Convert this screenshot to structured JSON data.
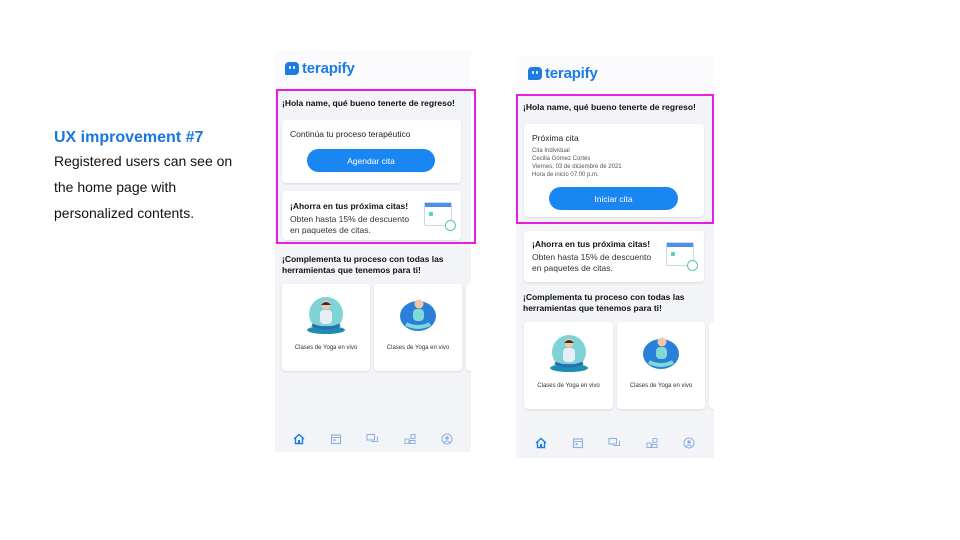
{
  "caption": {
    "title": "UX improvement #7",
    "lines": [
      "Registered users can see on",
      "the home page with",
      "personalized contents."
    ]
  },
  "brand": {
    "name": "terapify",
    "color": "#1a7de6"
  },
  "phone_left": {
    "greeting": "¡Hola name, qué bueno tenerte de regreso!",
    "process_text": "Continúa tu proceso terapéutico",
    "button": "Agendar cita",
    "promo_title": "¡Ahorra en tus próxima citas!",
    "promo_line1": "Obten hasta 15% de descuento",
    "promo_line2": "en paquetes de citas.",
    "section_line1": "¡Complementa tu proceso con todas las",
    "section_line2": "herramientas que tenemos para ti!",
    "tiles": [
      "Clases de Yoga en vivo",
      "Clases de Yoga en vivo"
    ]
  },
  "phone_right": {
    "greeting": "¡Hola name, qué bueno tenerte de regreso!",
    "next_title": "Próxima cita",
    "detail1": "Cita Individual",
    "detail2": "Cecilia Gómez Cortés",
    "detail3": "Viernes, 03 de diciembre de 2021",
    "detail4": "Hora de inicio 07:00 p.m.",
    "button": "Iniciar cita",
    "promo_title": "¡Ahorra en tus próxima citas!",
    "promo_line1": "Obten hasta 15% de descuento",
    "promo_line2": "en paquetes de citas.",
    "section_line1": "¡Complementa tu proceso con todas las",
    "section_line2": "herramientas que tenemos para ti!",
    "tiles": [
      "Clases de Yoga en vivo",
      "Clases de Yoga en vivo"
    ]
  },
  "nav_icons": [
    "home-icon",
    "calendar-icon",
    "chat-icon",
    "tools-icon",
    "profile-icon"
  ],
  "colors": {
    "highlight": "#e51ee0",
    "accent": "#1a86f2",
    "nav_active": "#1a7de6",
    "nav_inactive": "#8fb3e0"
  }
}
